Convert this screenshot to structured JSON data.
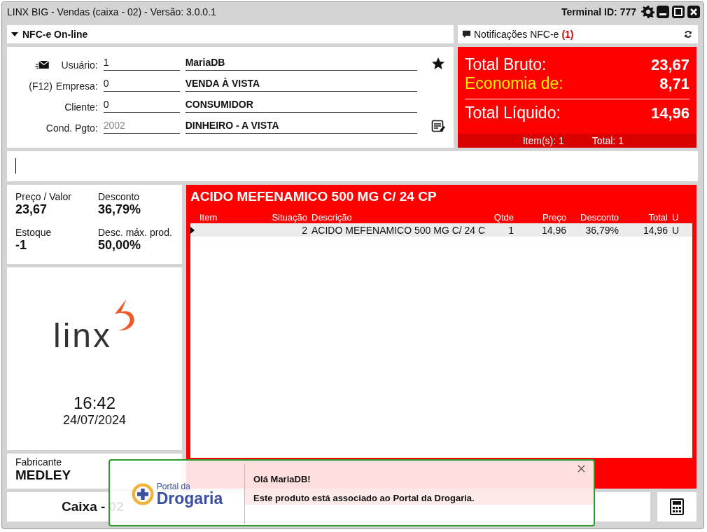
{
  "window": {
    "title": "LINX BIG - Vendas (caixa - 02) - Versão: 3.0.0.1",
    "terminal": "Terminal ID: 777"
  },
  "nfce": {
    "label": "NFC-e On-line",
    "expanded": true
  },
  "notifications": {
    "label": "Notificações NFC-e",
    "count": "(1)"
  },
  "form": [
    {
      "kind": "user",
      "label": "Usuário:",
      "code": "1",
      "value": "MariaDB",
      "disabled": false
    },
    {
      "kind": "company",
      "key": "(F12)",
      "label": "Empresa:",
      "code": "0",
      "value": "VENDA À VISTA",
      "disabled": false
    },
    {
      "kind": "plain",
      "label": "Cliente:",
      "code": "0",
      "value": "CONSUMIDOR",
      "disabled": false
    },
    {
      "kind": "payment",
      "label": "Cond. Pgto:",
      "code": "2002",
      "value": "DINHEIRO - A VISTA",
      "disabled": true
    }
  ],
  "totals": {
    "rows": [
      {
        "kind": "normal",
        "label": "Total Bruto:",
        "value": "23,67"
      },
      {
        "kind": "highlight",
        "label": "Economia de:",
        "value": "8,71"
      },
      {
        "kind": "net",
        "label": "Total Líquido:",
        "value": "14,96"
      }
    ],
    "items": "Item(s): 1",
    "total": "Total: 1"
  },
  "product_info": [
    {
      "label": "Preço / Valor",
      "value": "23,67"
    },
    {
      "label": "Desconto",
      "value": "36,79%"
    },
    {
      "label": "Estoque",
      "value": "-1"
    },
    {
      "label": "Desc. máx. prod.",
      "value": "50,00%"
    }
  ],
  "logo": {
    "text": "linx"
  },
  "clock": {
    "time": "16:42",
    "date": "24/07/2024"
  },
  "product": {
    "title": "ACIDO MEFENAMICO 500 MG C/ 24 CP",
    "columns": [
      "Item",
      "Situação",
      "Descrição",
      "Qtde",
      "Preço",
      "Desconto",
      "Total",
      "U"
    ],
    "rows": [
      {
        "selected": true,
        "cells": [
          "",
          "2",
          "ACIDO MEFENAMICO 500 MG C/ 24 C",
          "1",
          "14,96",
          "36,79%",
          "14,96",
          "U"
        ]
      }
    ]
  },
  "manufacturer": {
    "label": "Fabricante",
    "value": "MEDLEY"
  },
  "bottom": {
    "cashier": "Caixa - 02"
  },
  "popup": {
    "brand_small": "Portal da",
    "brand_large": "Drogaria",
    "title": "Olá MariaDB!",
    "message": "Este produto está associado ao Portal da Drogaria."
  }
}
